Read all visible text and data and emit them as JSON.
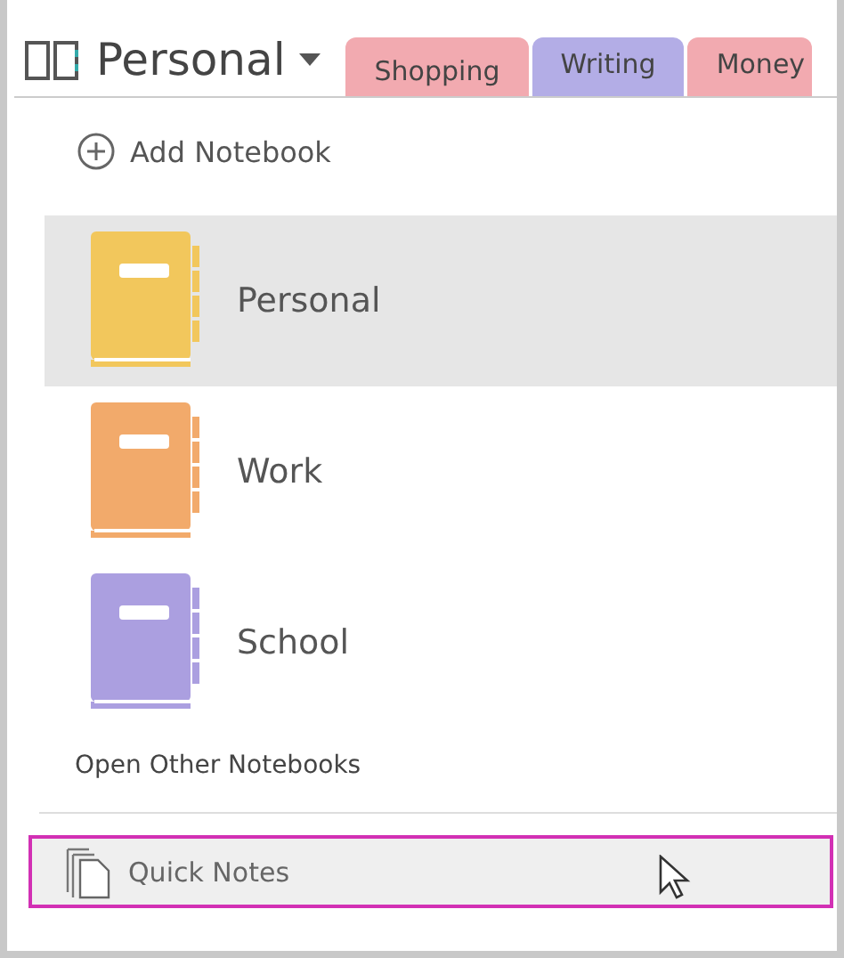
{
  "notebook_picker": {
    "title": "Personal"
  },
  "tabs": [
    {
      "label": "Shopping",
      "selected": true,
      "color": "#f2aab0"
    },
    {
      "label": "Writing",
      "selected": false,
      "color": "#b3ade6"
    },
    {
      "label": "Money",
      "selected": false,
      "color": "#f2aab0"
    }
  ],
  "add_notebook": "Add Notebook",
  "notebooks": [
    {
      "name": "Personal",
      "selected": true,
      "color": "#f2c75c"
    },
    {
      "name": "Work",
      "selected": false,
      "color": "#f2aa6b"
    },
    {
      "name": "School",
      "selected": false,
      "color": "#ab9fe0"
    }
  ],
  "open_other": "Open Other Notebooks",
  "quick_notes": {
    "label": "Quick Notes",
    "highlighted": true
  }
}
